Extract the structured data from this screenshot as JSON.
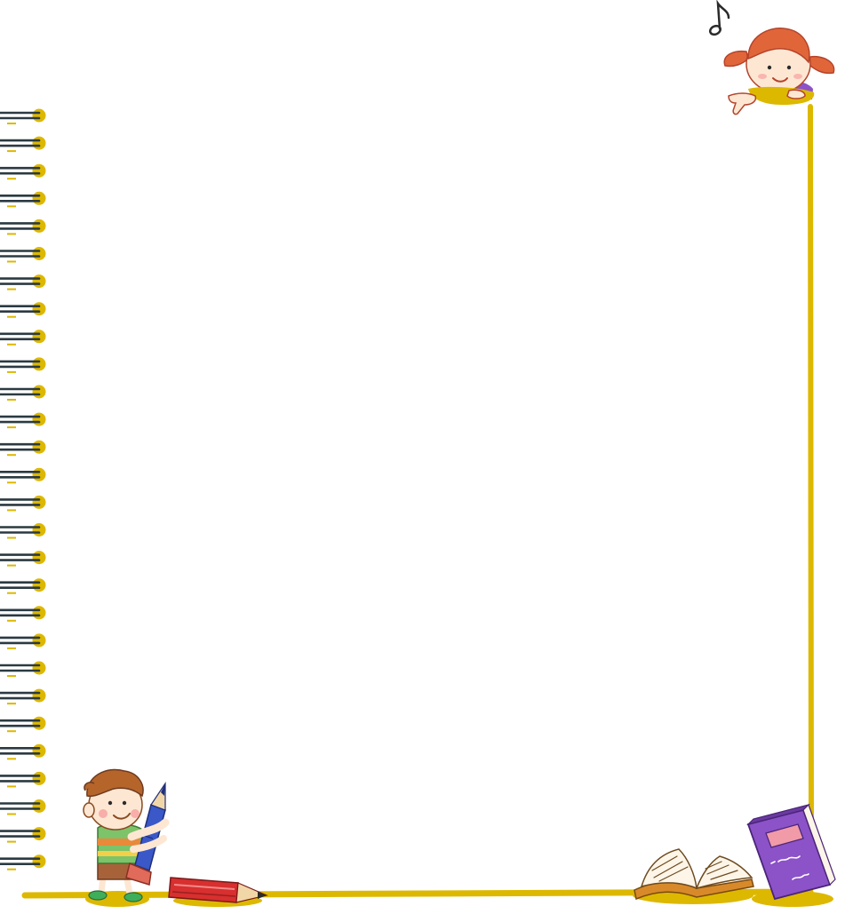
{
  "page": {
    "background": "#ffffff"
  },
  "frame": {
    "accent": "#ddb800",
    "ring_count": 28
  },
  "decor": {
    "icons": [
      "spiral-binding-icon",
      "music-note-icon",
      "girl-peeking-icon",
      "boy-hugging-pencil-icon",
      "red-pencil-icon",
      "open-book-icon",
      "purple-book-icon"
    ],
    "colors": {
      "wire": "#2b3a42",
      "pencil_red": "#d82f2f",
      "book_purple": "#8c52c8",
      "hair_orange": "#e0663a"
    }
  }
}
